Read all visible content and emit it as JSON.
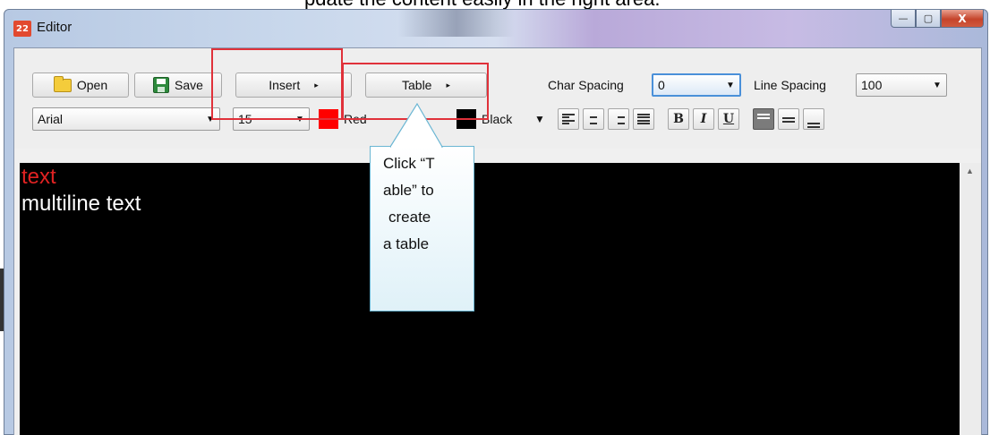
{
  "caption_partial": "pdate the content easily in the right area.",
  "window": {
    "title": "Editor",
    "app_icon_text": "22",
    "controls": {
      "minimize": "—",
      "maximize": "▢",
      "close": "X"
    }
  },
  "toolbar": {
    "open_label": "Open",
    "save_label": "Save",
    "insert_label": "Insert",
    "table_label": "Table",
    "char_spacing_label": "Char Spacing",
    "char_spacing_value": "0",
    "line_spacing_label": "Line Spacing",
    "line_spacing_value": "100",
    "font_value": "Arial",
    "size_value": "15",
    "text_color_label": "Red",
    "text_color": "#ff0000",
    "bg_color_label": "Black",
    "bg_color": "#000000",
    "bold": "B",
    "italic": "I",
    "underline": "U"
  },
  "canvas": {
    "line1": "text",
    "line1_color": "#e02222",
    "line2": "multiline text",
    "line2_color": "#ffffff"
  },
  "callout": {
    "lines": [
      "Click “T",
      "able” to",
      "create",
      "a table"
    ]
  },
  "colors": {
    "highlight_border": "#e0313a",
    "callout_border": "#6ab6d3"
  }
}
